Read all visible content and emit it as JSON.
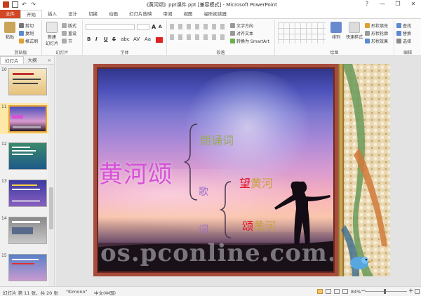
{
  "window": {
    "title": "《黄河颂》ppt课件.ppt [兼容模式] - Microsoft PowerPoint",
    "controls": [
      "?",
      "—",
      "❐",
      "✕"
    ]
  },
  "ribbon_tabs": [
    "文件",
    "开始",
    "插入",
    "设计",
    "切换",
    "动画",
    "幻灯片放映",
    "审阅",
    "视图",
    "福昕阅读器"
  ],
  "ribbon": {
    "clipboard": {
      "paste": "粘贴",
      "cut": "剪切",
      "copy": "复制",
      "format_painter": "格式刷",
      "label": "剪贴板"
    },
    "slides": {
      "new_slide": "新建\n幻灯片",
      "layout": "版式",
      "reset": "重设",
      "section": "节",
      "label": "幻灯片"
    },
    "font": {
      "label": "字体",
      "grow": "A",
      "shrink": "A",
      "bold": "B",
      "italic": "I",
      "underline": "U",
      "strike": "S",
      "shadow": "abc",
      "spacing": "AV",
      "case": "Aa"
    },
    "paragraph": {
      "text_direction": "文字方向",
      "align_text": "对齐文本",
      "smartart": "转换为 SmartArt",
      "label": "段落"
    },
    "drawing": {
      "arrange": "排列",
      "quick_styles": "快速样式",
      "fill": "形状填充",
      "outline": "形状轮廓",
      "effects": "形状效果",
      "label": "绘图"
    },
    "editing": {
      "find": "查找",
      "replace": "替换",
      "select": "选择",
      "label": "编辑"
    }
  },
  "left_pane": {
    "tabs": [
      "幻灯片",
      "大纲"
    ],
    "close": "×",
    "thumbnails": [
      {
        "num": "10"
      },
      {
        "num": "11"
      },
      {
        "num": "12"
      },
      {
        "num": "13"
      },
      {
        "num": "14"
      },
      {
        "num": "15"
      }
    ],
    "selected": "11"
  },
  "slide": {
    "title_main": "黄河颂",
    "langsong": "朗诵词",
    "ge": "歌",
    "he": "词",
    "wang_red": "望",
    "wang_gold": "黄河",
    "song_red": "颂",
    "song_gold": "黄河",
    "watermark": "os.pconline.com.c"
  },
  "statusbar": {
    "slide_info": "幻灯片 第 11 张，共 20 张",
    "theme": "\"Kimono\"",
    "language": "中文(中国)",
    "zoom": "84%",
    "zoom_minus": "−",
    "zoom_plus": "+"
  },
  "colors": {
    "file_tab": "#d24726",
    "selected_thumb": "#fde8a8",
    "title_magenta": "#d850d8",
    "red": "#e01020",
    "gold": "#c8a040"
  }
}
